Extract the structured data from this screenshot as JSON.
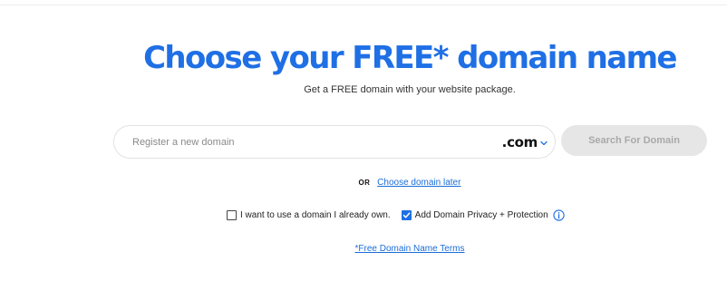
{
  "hero": {
    "title": "Choose your FREE* domain name",
    "subtitle": "Get a FREE domain with your website package."
  },
  "search": {
    "placeholder": "Register a new domain",
    "value": "",
    "tld": ".com",
    "button_label": "Search For Domain"
  },
  "alternative": {
    "or_label": "OR",
    "choose_later_label": "Choose domain later"
  },
  "options": {
    "use_own_domain": {
      "label": "I want to use a domain I already own.",
      "checked": false
    },
    "privacy_protection": {
      "label": "Add Domain Privacy + Protection",
      "checked": true
    }
  },
  "footer": {
    "terms_label": "*Free Domain Name Terms"
  },
  "colors": {
    "accent": "#1f6fe5",
    "link": "#1a6dd9",
    "button_disabled_bg": "#e6e6e6",
    "button_disabled_text": "#a9a9a9"
  },
  "icons": {
    "tld_dropdown": "chevron-down-icon",
    "checkmark": "checkmark-icon",
    "info": "info-icon"
  }
}
